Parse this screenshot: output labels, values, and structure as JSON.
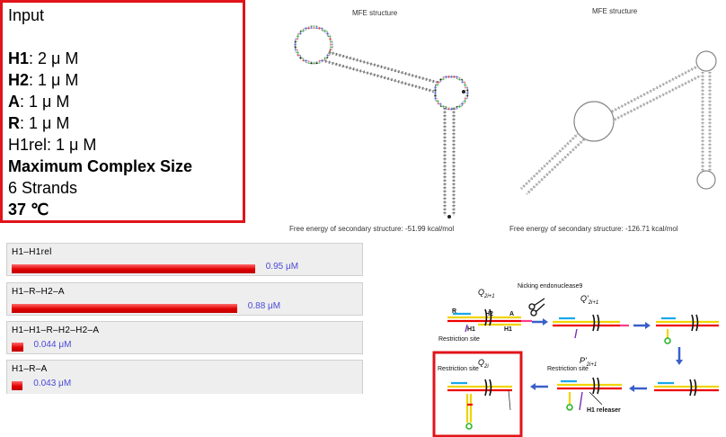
{
  "input": {
    "title": "Input",
    "h1_label": "H1",
    "h1_value": ": 2 μ M",
    "h2_label": "H2",
    "h2_value": ": 1 μ M",
    "a_label": "A",
    "a_value": ": 1 μ M",
    "r_label": "R",
    "r_value": ": 1 μ M",
    "h1rel": "H1rel: 1 μ M",
    "max_label": "Maximum Complex Size",
    "strands": "6 Strands",
    "temp": "37 ℃"
  },
  "results": [
    {
      "name": "H1–H1rel",
      "value_text": "0.95 μM",
      "fraction": 0.95
    },
    {
      "name": "H1–R–H2–A",
      "value_text": "0.88 μM",
      "fraction": 0.88
    },
    {
      "name": "H1–H1–R–H2–H2–A",
      "value_text": "0.044 μM",
      "fraction": 0.044
    },
    {
      "name": "H1–R–A",
      "value_text": "0.043 μM",
      "fraction": 0.043
    }
  ],
  "mfe_left": {
    "title": "MFE structure",
    "energy": "Free energy of secondary structure: -51.99 kcal/mol"
  },
  "mfe_right": {
    "title": "MFE structure",
    "energy": "Free energy of secondary structure: -126.71 kcal/mol"
  },
  "scheme": {
    "q_top": "Q",
    "q_top_sub": "2i+1",
    "nicking": "Nicking endonuclease9",
    "qp_top": "Q'",
    "qp_top_sub": "2i+1",
    "label_R": "R",
    "label_H1": "H1",
    "label_H2": "H2",
    "label_A": "A",
    "label_H1b": "H1",
    "restriction_site": "Restriction site",
    "q_bottom": "Q",
    "q_bottom_sub": "2i",
    "p_bottom": "P'",
    "p_bottom_sub": "2i+1",
    "h1_releaser": "H1 releaser"
  }
}
